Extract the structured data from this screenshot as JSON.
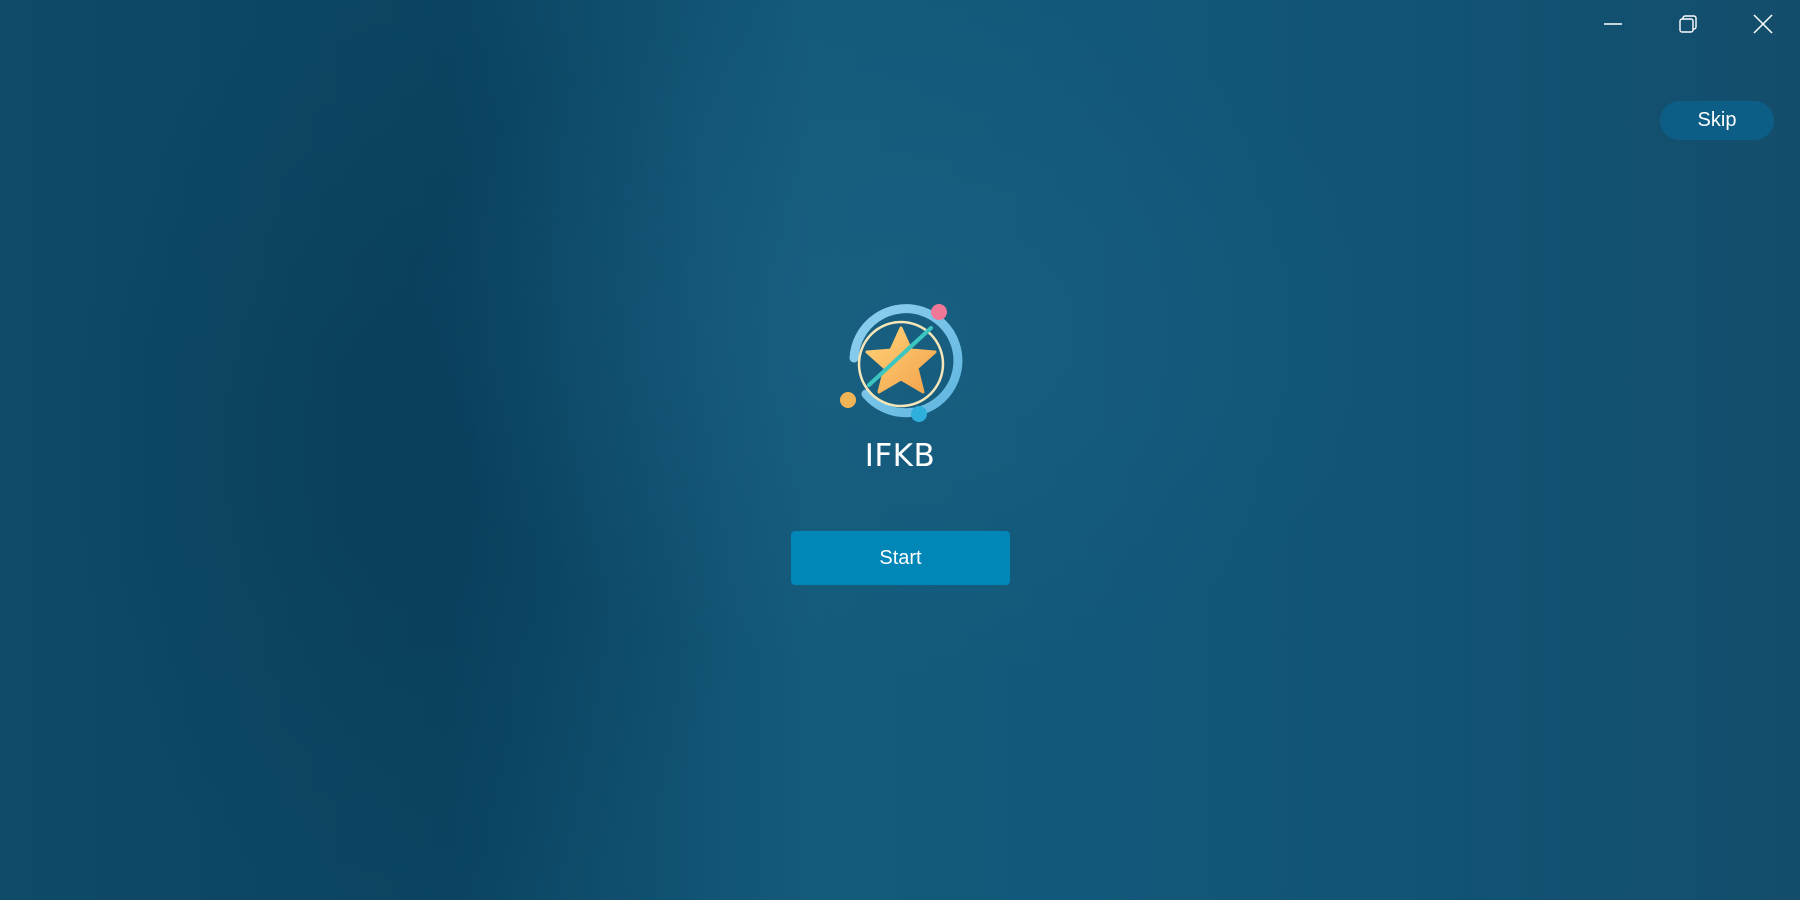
{
  "window": {
    "controls": [
      {
        "name": "minimize-icon"
      },
      {
        "name": "restore-icon"
      },
      {
        "name": "close-icon"
      }
    ]
  },
  "header": {
    "skip_label": "Skip"
  },
  "main": {
    "logo_icon": "star-orbit-logo-icon",
    "app_name": "IFKB",
    "start_label": "Start"
  },
  "colors": {
    "accent": "#0087b8",
    "skip_bg": "#0d5e86",
    "background": "#12557a"
  }
}
